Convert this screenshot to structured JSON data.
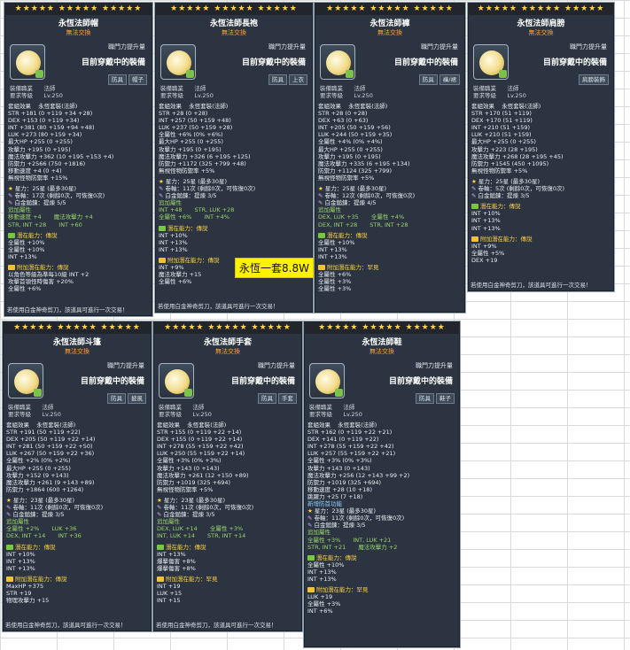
{
  "callout": "永恆一套8.8W",
  "stars": "★★★★★ ★★★★★ ★★★★★",
  "common": {
    "untradeable": "無法交換",
    "rank_label": "職門力提升量",
    "current": "目前穿戴中的裝備",
    "job_label": "裝備職業",
    "job": "法師",
    "level_label": "要求等級",
    "level": "Lv.250",
    "set_label": "套組效果",
    "set": "永恆套裝(法師)",
    "star": "星力：",
    "hammer": "卷軸：",
    "platinum": "白金鎚鍊：",
    "extra": "追加屬性",
    "potential": "潛在能力：",
    "bonus": "附加潛在能力：",
    "legend": "傳說",
    "unique": "罕見",
    "footer": "若使用白金神奇剪刀，該道具可進行一次交易！"
  },
  "items": [
    {
      "title": "永恆法師帽",
      "tags": [
        "防具",
        "帽子"
      ],
      "stats": [
        "STR +181 (0 +119 +34 +28)",
        "DEX +153 (0 +119 +34)",
        "INT +381 (80 +159 +94 +48)",
        "LUK +273 (80 +159 +34)",
        "最大HP +255 (0 +255)",
        "攻擊力 +195 (0 +195)",
        "魔法攻擊力 +362 (10 +195 +153 +4)",
        "防禦力 +2566 (750 +1816)",
        "移動速度 +4 (0 +4)",
        "無視怪物防禦率 +15%"
      ],
      "star": "25星 (最多30星)",
      "hammer": "17次 (剩餘0次，可恢復0次)",
      "platinum": "提煉 5/5",
      "extra": [
        "移動速度 +4",
        "魔法攻擊力 +4",
        "STR, INT +28",
        "INT +60"
      ],
      "pot": [
        "全屬性 +10%",
        "全屬性 +10%",
        "INT +13%"
      ],
      "bonus": [
        "以角色等級為準每10級 INT +2",
        "攻擊首領怪時傷害 +20%",
        "全屬性 +6%"
      ]
    },
    {
      "title": "永恆法師長袍",
      "tags": [
        "防具",
        "上衣"
      ],
      "stats": [
        "STR +28 (0 +28)",
        "INT +257 (50 +159 +48)",
        "LUK +237 (50 +159 +28)",
        "全屬性 +6% (0% +6%)",
        "最大HP +255 (0 +255)",
        "攻擊力 +195 (0 +195)",
        "魔法攻擊力 +326 (6 +195 +125)",
        "防禦力 +1172 (325 +799 +48)",
        "無視怪物防禦率 +5%"
      ],
      "star": "25星 (最多30星)",
      "hammer": "11次 (剩餘0次，可恢復0次)",
      "platinum": "提煉 3/5",
      "extra": [
        "INT +48",
        "STR, LUK +28",
        "全屬性 +6%",
        "INT +4%"
      ],
      "pot": [
        "INT +10%",
        "INT +13%",
        "INT +13%"
      ],
      "bonus": [
        "INT +9%",
        "魔法攻擊力 +15",
        "全屬性 +6%"
      ]
    },
    {
      "title": "永恆法師褲",
      "tags": [
        "防具",
        "褲/裙"
      ],
      "stats": [
        "STR +28 (0 +28)",
        "DEX +63 (0 +63)",
        "INT +205 (50 +159 +56)",
        "LUK +244 (50 +159 +35)",
        "全屬性 +4% (0% +4%)",
        "最大HP +255 (0 +255)",
        "攻擊力 +195 (0 +195)",
        "魔法攻擊力 +335 (6 +195 +134)",
        "防禦力 +1124 (325 +799)",
        "無視怪物防禦率 +5%"
      ],
      "star": "25星 (最多30星)",
      "hammer": "12次 (剩餘0次，可恢復0次)",
      "platinum": "提煉 4/5",
      "extra": [
        "DEX, LUK +35",
        "全屬性 +4%",
        "DEX, INT +28",
        "STR, INT +28"
      ],
      "pot": [
        "全屬性 +10%",
        "INT +13%",
        "INT +13%"
      ],
      "bonus": [
        "全屬性 +6%",
        "全屬性 +3%",
        "全屬性 +3%"
      ]
    },
    {
      "title": "永恆法師肩膀",
      "tags": [
        "肩膀裝飾"
      ],
      "stats": [
        "STR +170 (51 +119)",
        "DEX +170 (51 +119)",
        "INT +210 (51 +159)",
        "LUK +210 (51 +159)",
        "最大HP +255 (0 +255)",
        "攻擊力 +223 (28 +195)",
        "魔法攻擊力 +268 (28 +195 +45)",
        "防禦力 +1545 (450 +1095)",
        "無視怪物防禦率 +5%"
      ],
      "star": "25星 (最多30星)",
      "hammer": "5次 (剩餘0次，可恢復0次)",
      "platinum": "提煉 3/5",
      "extra": [],
      "pot": [
        "INT +10%",
        "INT +13%",
        "INT +13%"
      ],
      "bonus": [
        "INT +9%",
        "全屬性 +5%",
        "DEX +19"
      ]
    },
    {
      "title": "永恆法師斗篷",
      "tags": [
        "防具",
        "披風"
      ],
      "stats": [
        "STR +191 (50 +119 +22)",
        "DEX +205 (50 +119 +22 +14)",
        "INT +281 (50 +159 +22 +50)",
        "LUK +267 (50 +159 +22 +36)",
        "全屬性 +2% (0% +2%)",
        "最大HP +255 (0 +255)",
        "攻擊力 +152 (9 +143)",
        "魔法攻擊力 +261 (9 +143 +89)",
        "防禦力 +1864 (600 +1264)"
      ],
      "star": "23星 (最多30星)",
      "hammer": "11次 (剩餘0次，可恢復0次)",
      "platinum": "提煉 3/5",
      "extra": [
        "全屬性 +2%",
        "LUK +36",
        "DEX, INT +14",
        "INT +36"
      ],
      "pot": [
        "INT +10%",
        "INT +13%",
        "INT +13%"
      ],
      "bonus": [
        "MaxHP +375",
        "STR +19",
        "物理攻擊力 +15"
      ]
    },
    {
      "title": "永恆法師手套",
      "tags": [
        "防具",
        "手套"
      ],
      "stats": [
        "STR +155 (0 +119 +22 +14)",
        "DEX +155 (0 +119 +22 +14)",
        "INT +278 (55 +159 +22 +42)",
        "LUK +250 (55 +159 +22 +14)",
        "全屬性 +3% (0% +3%)",
        "攻擊力 +143 (0 +143)",
        "魔法攻擊力 +261 (12 +150 +89)",
        "防禦力 +1019 (325 +694)",
        "無視怪物防禦率 +5%"
      ],
      "star": "23星 (最多30星)",
      "hammer": "11次 (剩餘0次，可恢復0次)",
      "platinum": "提煉 3/5",
      "extra": [
        "DEX, LUK +14",
        "全屬性 +3%",
        "INT, LUK +14",
        "STR, INT +14"
      ],
      "pot": [
        "INT +13%",
        "爆擊傷害 +8%",
        "爆擊傷害 +8%"
      ],
      "bonus": [
        "INT +19",
        "LUK +15",
        "INT +15"
      ]
    },
    {
      "title": "永恆法師鞋",
      "tags": [
        "防具",
        "鞋子"
      ],
      "stats": [
        "STR +162 (0 +119 +22 +21)",
        "DEX +141 (0 +119 +22)",
        "INT +278 (55 +159 +22 +42)",
        "LUK +257 (55 +159 +22 +21)",
        "全屬性 +3% (0% +3%)",
        "攻擊力 +143 (0 +143)",
        "魔法攻擊力 +256 (12 +143 +99 +2)",
        "防禦力 +1019 (325 +694)",
        "移動速度 +28 (10 +18)",
        "跳躍力 +25 (7 +18)"
      ],
      "star": "23星 (最多30星)",
      "hammer": "11次 (剩餘0次，可恢復0次)",
      "platinum": "提煉 3/5",
      "extra": [
        "全屬性 +3%",
        "INT, LUK +21",
        "STR, INT +21",
        "魔法攻擊力 +2"
      ],
      "pot": [
        "全屬性 +10%",
        "INT +13%",
        "INT +13%"
      ],
      "bonus": [
        "LUK +19",
        "全屬性 +3%",
        "INT +6%"
      ],
      "special": "新增防首功能"
    }
  ]
}
